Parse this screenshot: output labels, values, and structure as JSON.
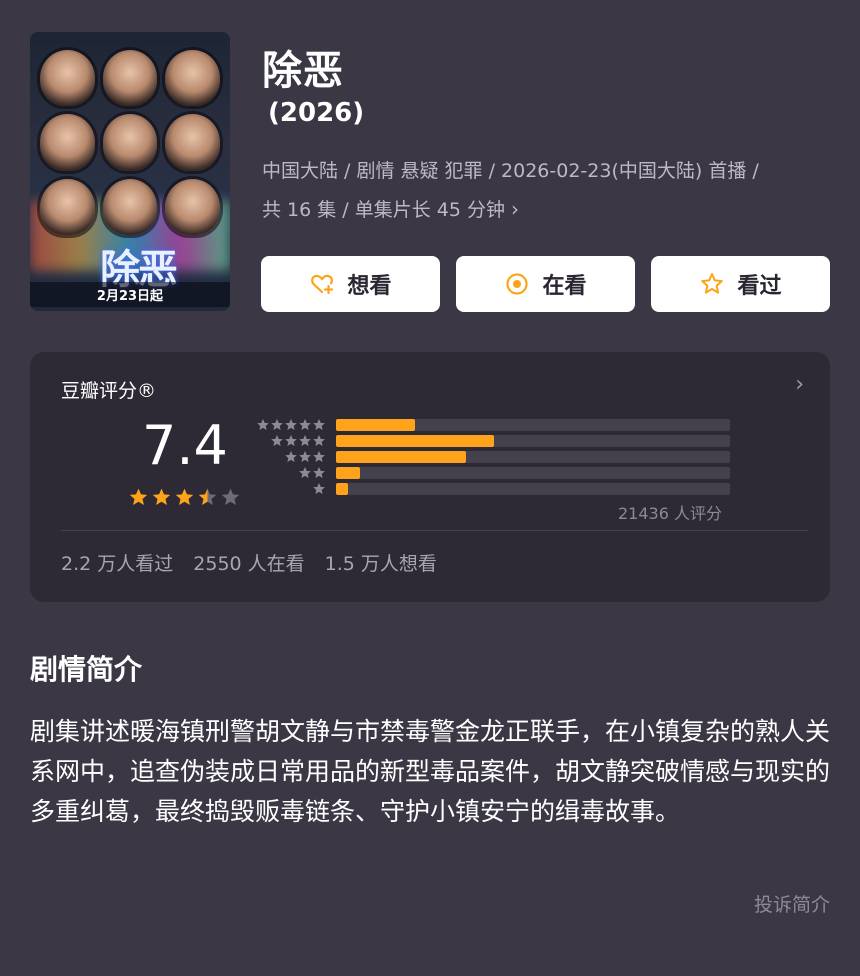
{
  "poster": {
    "title_text": "除恶",
    "date_text": "2月23日起"
  },
  "show": {
    "title": "除恶",
    "year": " (2026)",
    "meta_line1": "中国大陆 / 剧情 悬疑 犯罪 / 2026-02-23(中国大陆) 首播 /",
    "meta_line2": "共 16 集 / 单集片长 45 分钟",
    "meta_chevron": "›"
  },
  "actions": {
    "want_label": "想看",
    "watching_label": "在看",
    "watched_label": "看过"
  },
  "rating": {
    "section_title": "豆瓣评分®",
    "chevron": "›",
    "score": "7.4",
    "star_rating": 3.5,
    "distribution": [
      0.2,
      0.4,
      0.33,
      0.06,
      0.03
    ],
    "count_text": "21436 人评分",
    "watched_text": "2.2 万人看过",
    "watching_text": "2550 人在看",
    "want_text": "1.5 万人想看"
  },
  "synopsis": {
    "heading": "剧情简介",
    "text": "剧集讲述暖海镇刑警胡文静与市禁毒警金龙正联手，在小镇复杂的熟人关系网中，追查伪装成日常用品的新型毒品案件，胡文静突破情感与现实的多重纠葛，最终捣毁贩毒链条、守护小镇安宁的缉毒故事。",
    "report_label": "投诉简介"
  },
  "colors": {
    "background": "#3b3744",
    "card": "#2d2a35",
    "accent": "#ffa31a",
    "star_empty": "#6e6a78"
  }
}
